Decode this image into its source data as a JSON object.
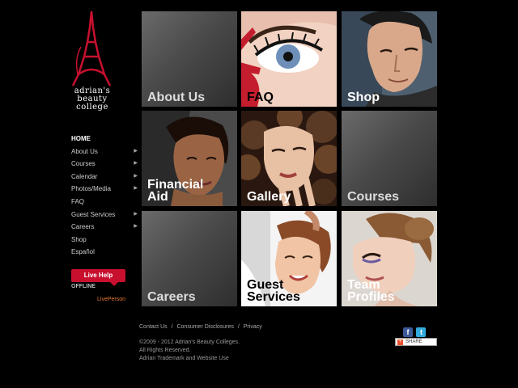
{
  "brand": {
    "lines": [
      "adrian's",
      "beauty",
      "college"
    ],
    "logo_icon": "eiffel-tower-icon",
    "accent": "#c8102e"
  },
  "nav": {
    "items": [
      {
        "label": "HOME",
        "has_submenu": false,
        "active": true
      },
      {
        "label": "About Us",
        "has_submenu": true
      },
      {
        "label": "Courses",
        "has_submenu": true
      },
      {
        "label": "Calendar",
        "has_submenu": true
      },
      {
        "label": "Photos/Media",
        "has_submenu": true
      },
      {
        "label": "FAQ",
        "has_submenu": false
      },
      {
        "label": "Guest Services",
        "has_submenu": true
      },
      {
        "label": "Careers",
        "has_submenu": true
      },
      {
        "label": "Shop",
        "has_submenu": false
      },
      {
        "label": "Español",
        "has_submenu": false
      }
    ]
  },
  "live_help": {
    "button": "Live Help",
    "status": "OFFLINE",
    "provider": "LivePerson"
  },
  "tiles": [
    {
      "label": "About Us",
      "style": "gray"
    },
    {
      "label": "FAQ",
      "style": "photo-eye"
    },
    {
      "label": "Shop",
      "style": "photo-man"
    },
    {
      "label": "Financial\nAid",
      "style": "photo-woman-dark"
    },
    {
      "label": "Gallery",
      "style": "photo-woman-curls"
    },
    {
      "label": "Courses",
      "style": "gray"
    },
    {
      "label": "Careers",
      "style": "gray"
    },
    {
      "label": "Guest\nServices",
      "style": "photo-stylist"
    },
    {
      "label": "Team\nProfiles",
      "style": "photo-updo"
    }
  ],
  "footer": {
    "links": [
      "Contact Us",
      "Consumer Disclosures",
      "Privacy"
    ],
    "separator": "/",
    "copyright": [
      "©2009 - 2012 Adrian's Beauty Colleges.",
      "All Rights Reserved.",
      "Adrian Trademark and Website Use"
    ],
    "share_label": "SHARE",
    "social": [
      {
        "name": "facebook-icon",
        "glyph": "f",
        "color": "#3b5998"
      },
      {
        "name": "twitter-icon",
        "glyph": "t",
        "color": "#33aadd"
      }
    ]
  }
}
